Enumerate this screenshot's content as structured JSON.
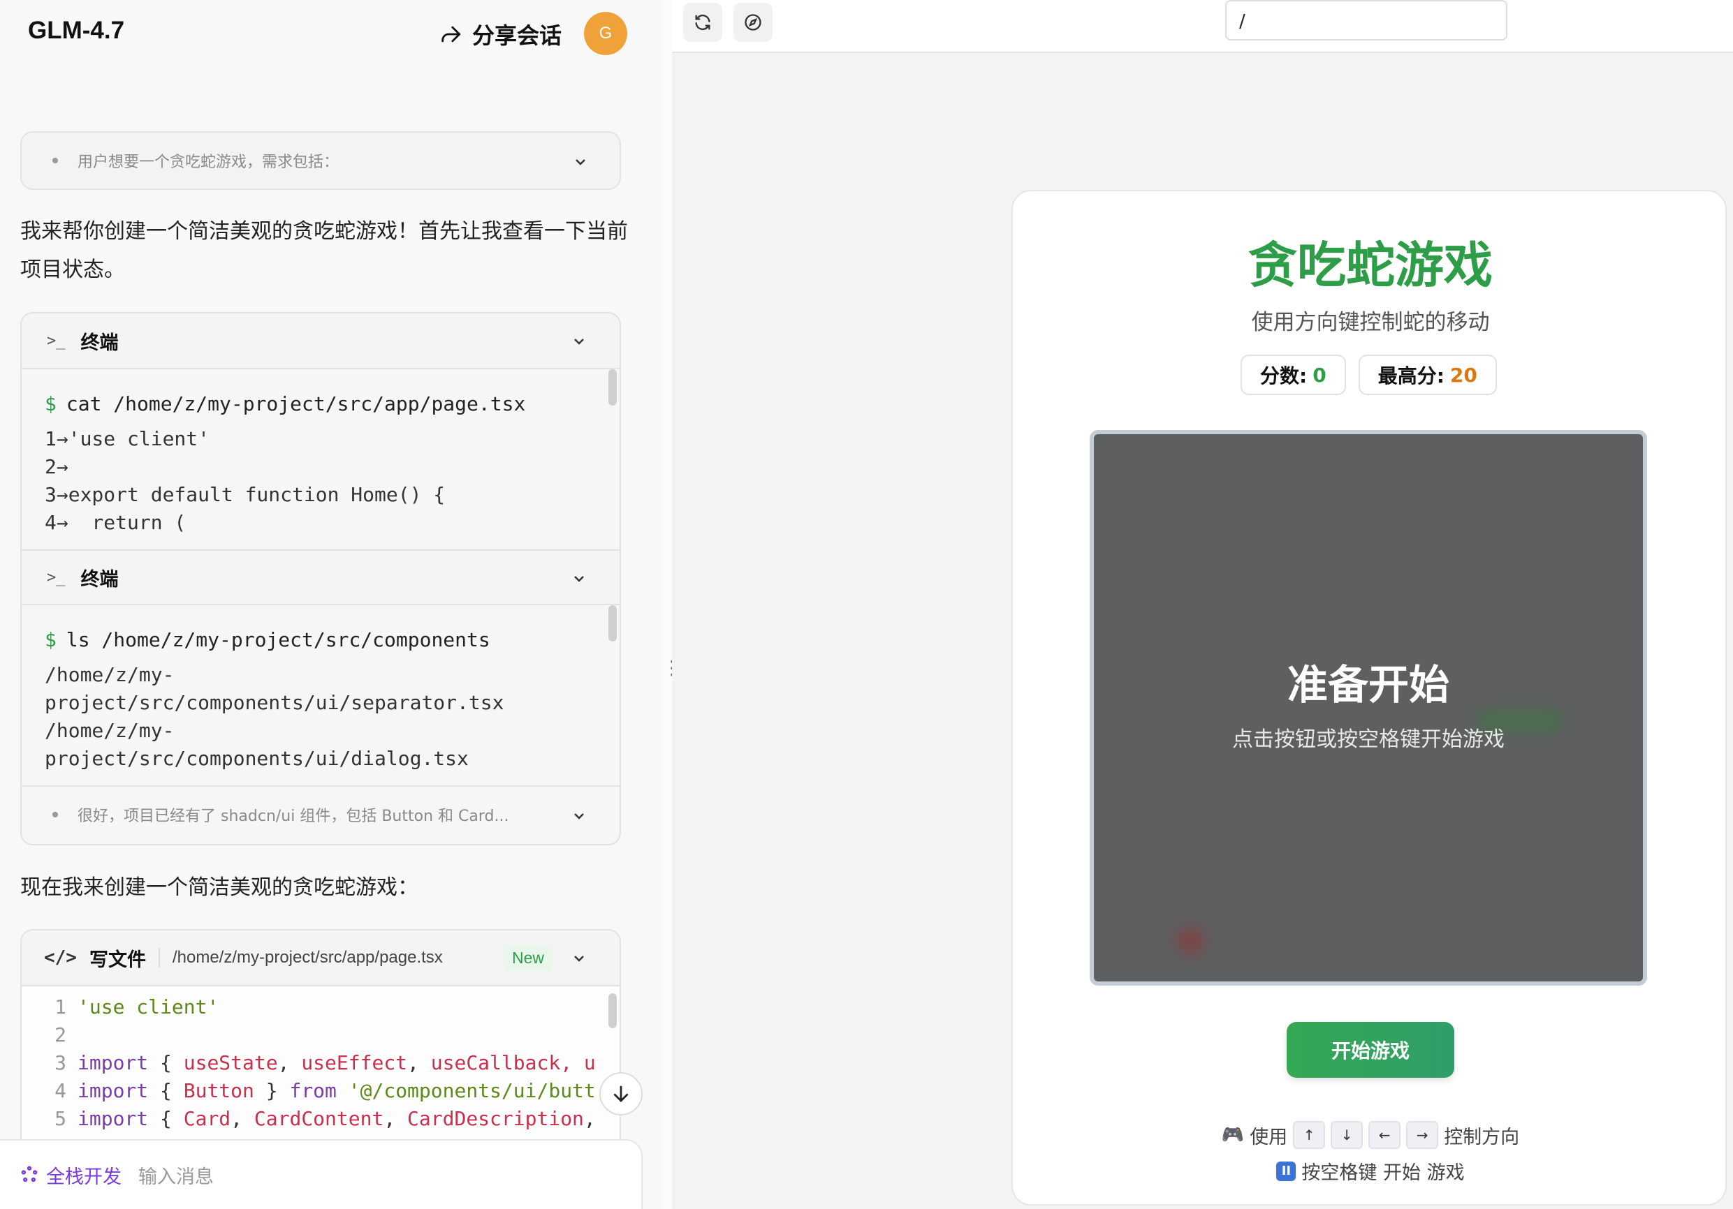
{
  "header": {
    "model_name": "GLM-4.7",
    "share_label": "分享会话",
    "avatar_letter": "G"
  },
  "chat": {
    "thinking_1": "用户想要一个贪吃蛇游戏，需求包括：",
    "intro_text": "我来帮你创建一个简洁美观的贪吃蛇游戏！首先让我查看一下当前项目状态。",
    "terminal_1": {
      "title": "终端",
      "command": "cat /home/z/my-project/src/app/page.tsx",
      "output": [
        "1→'use client'",
        "2→",
        "3→export default function Home() {",
        "4→  return ("
      ]
    },
    "terminal_2": {
      "title": "终端",
      "command": "ls /home/z/my-project/src/components",
      "output": [
        "/home/z/my-",
        "project/src/components/ui/separator.tsx",
        "/home/z/my-",
        "project/src/components/ui/dialog.tsx"
      ]
    },
    "thinking_2": "很好，项目已经有了 shadcn/ui 组件，包括 Button 和 Card...",
    "create_text": "现在我来创建一个简洁美观的贪吃蛇游戏：",
    "write_file": {
      "title": "写文件",
      "path": "/home/z/my-project/src/app/page.tsx",
      "badge": "New",
      "code": [
        {
          "n": "1",
          "parts": [
            {
              "t": "'use client'",
              "c": "str"
            }
          ]
        },
        {
          "n": "2",
          "parts": []
        },
        {
          "n": "3",
          "parts": [
            {
              "t": "import",
              "c": "kw"
            },
            {
              "t": " { ",
              "c": "pl"
            },
            {
              "t": "useState",
              "c": "id"
            },
            {
              "t": ", ",
              "c": "pl"
            },
            {
              "t": "useEffect",
              "c": "id"
            },
            {
              "t": ", ",
              "c": "pl"
            },
            {
              "t": "useCallback",
              "c": "id"
            },
            {
              "t": ", u",
              "c": "id"
            }
          ]
        },
        {
          "n": "4",
          "parts": [
            {
              "t": "import",
              "c": "kw"
            },
            {
              "t": " { ",
              "c": "pl"
            },
            {
              "t": "Button",
              "c": "id"
            },
            {
              "t": " } ",
              "c": "pl"
            },
            {
              "t": "from",
              "c": "kw"
            },
            {
              "t": " '@/components/ui/butt",
              "c": "str"
            }
          ]
        },
        {
          "n": "5",
          "parts": [
            {
              "t": "import",
              "c": "kw"
            },
            {
              "t": " { ",
              "c": "pl"
            },
            {
              "t": "Card",
              "c": "id"
            },
            {
              "t": ", ",
              "c": "pl"
            },
            {
              "t": "CardContent",
              "c": "id"
            },
            {
              "t": ", ",
              "c": "pl"
            },
            {
              "t": "CardDescription",
              "c": "id"
            },
            {
              "t": ",",
              "c": "pl"
            }
          ]
        }
      ]
    }
  },
  "input": {
    "mode_label": "全栈开发",
    "placeholder": "输入消息"
  },
  "preview": {
    "url": "/",
    "game": {
      "title": "贪吃蛇游戏",
      "subtitle": "使用方向键控制蛇的移动",
      "score_label": "分数:",
      "score_value": "0",
      "best_label": "最高分:",
      "best_value": "20",
      "overlay_title": "准备开始",
      "overlay_sub": "点击按钮或按空格键开始游戏",
      "start_button": "开始游戏",
      "help_use": "使用",
      "keys": [
        "↑",
        "↓",
        "←",
        "→"
      ],
      "help_control": "控制方向",
      "help_space": "按空格键 开始 游戏"
    }
  },
  "colors": {
    "accent_green": "#2e9d48",
    "best_orange": "#d97a10",
    "avatar_orange": "#f0a23a",
    "mode_purple": "#7a3ce0"
  }
}
